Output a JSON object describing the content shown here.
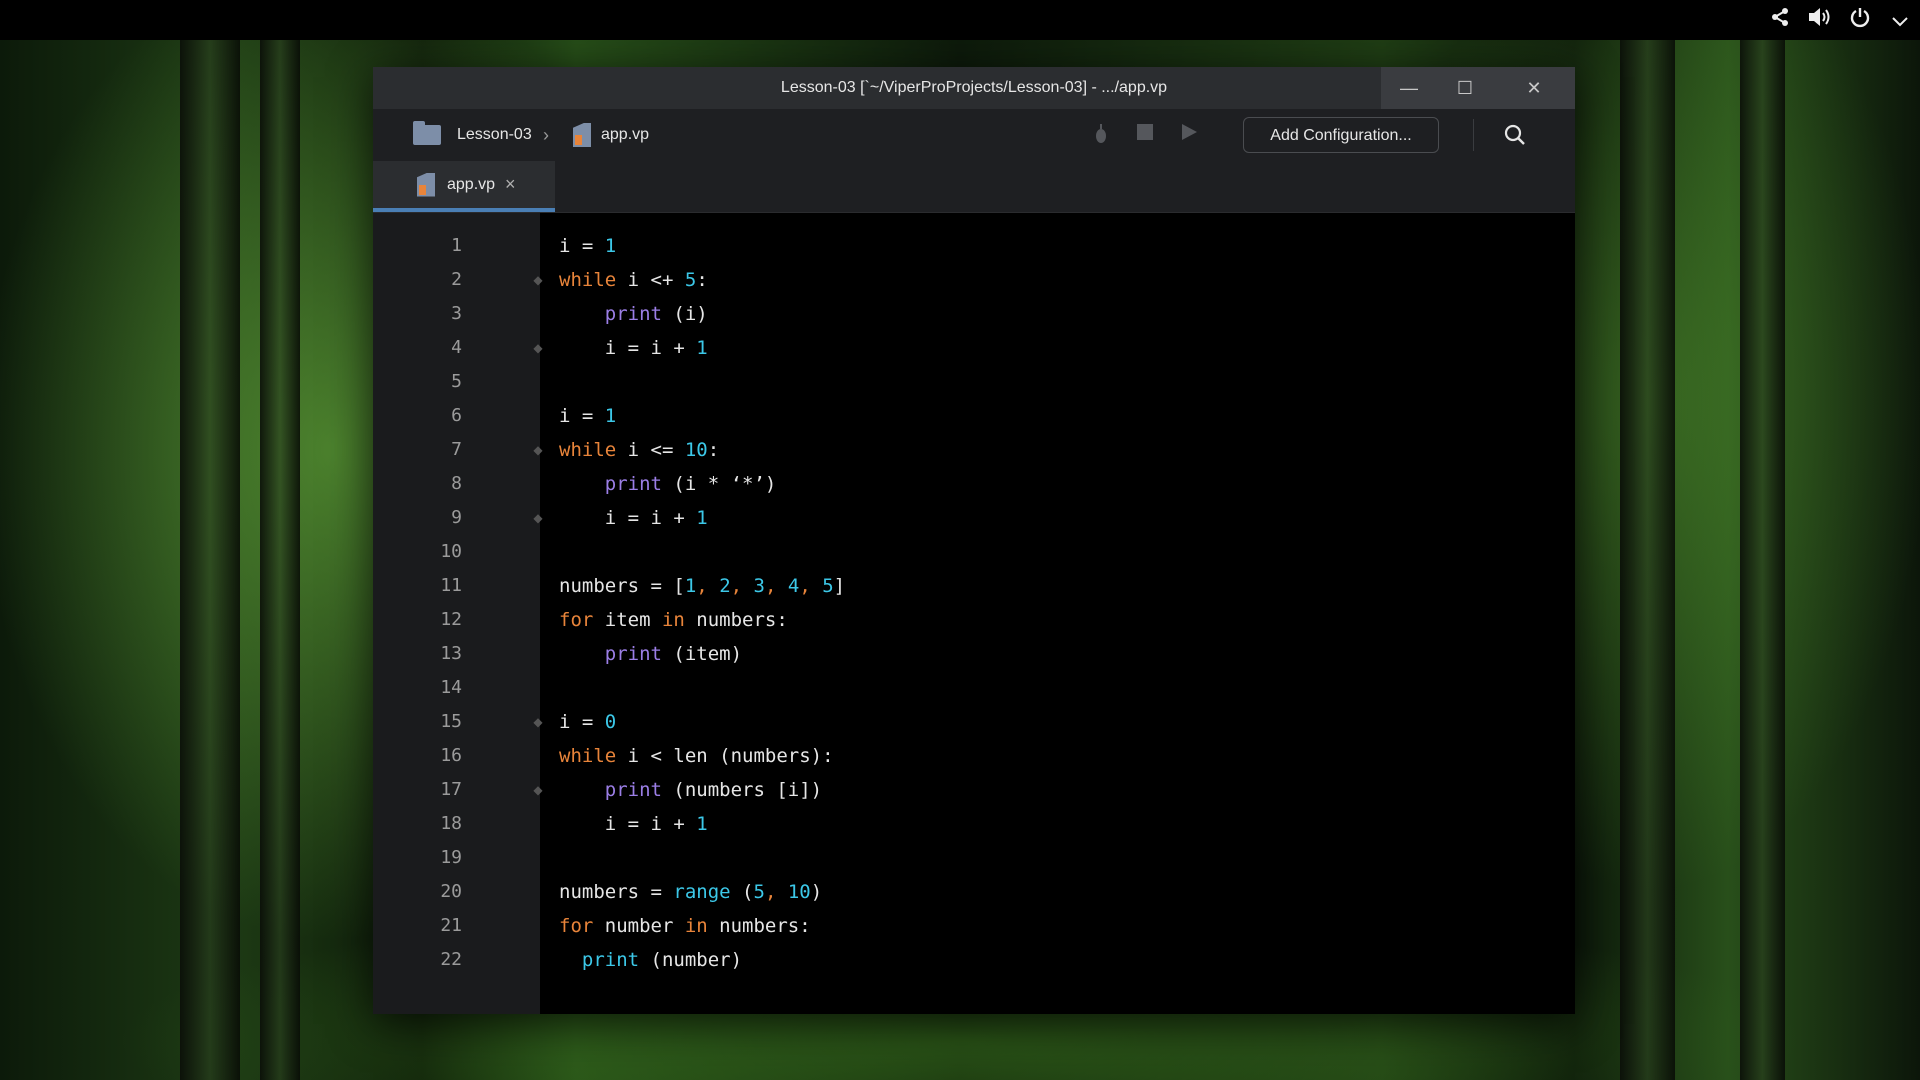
{
  "system_tray": {
    "icons": [
      "share-icon",
      "volume-icon",
      "power-icon",
      "chevron-down-icon"
    ]
  },
  "window": {
    "title": "Lesson-03 [`~/ViperProProjects/Lesson-03] - .../app.vp",
    "controls": {
      "minimize": "—",
      "maximize": "☐",
      "close": "✕"
    }
  },
  "navbar": {
    "project": "Lesson-03",
    "separator": "›",
    "file": "app.vp",
    "add_config_label": "Add Configuration..."
  },
  "tabs": [
    {
      "label": "app.vp",
      "active": true,
      "close": "×"
    }
  ],
  "editor": {
    "lines": [
      {
        "n": "1",
        "indent": "",
        "tokens": [
          [
            "id",
            "i"
          ],
          [
            "op",
            " = "
          ],
          [
            "num",
            "1"
          ]
        ]
      },
      {
        "n": "2",
        "indent": "",
        "tokens": [
          [
            "kw",
            "while"
          ],
          [
            "id",
            " i "
          ],
          [
            "op",
            "<+ "
          ],
          [
            "num",
            "5"
          ],
          [
            "op",
            ":"
          ]
        ],
        "fold": true
      },
      {
        "n": "3",
        "indent": "    ",
        "tokens": [
          [
            "fn",
            "print"
          ],
          [
            "op",
            " (i)"
          ]
        ]
      },
      {
        "n": "4",
        "indent": "    ",
        "tokens": [
          [
            "id",
            "i"
          ],
          [
            "op",
            " = i + "
          ],
          [
            "num",
            "1"
          ]
        ],
        "fold": true
      },
      {
        "n": "5",
        "indent": "",
        "tokens": []
      },
      {
        "n": "6",
        "indent": "",
        "tokens": [
          [
            "id",
            "i"
          ],
          [
            "op",
            " = "
          ],
          [
            "num",
            "1"
          ]
        ]
      },
      {
        "n": "7",
        "indent": "",
        "tokens": [
          [
            "kw",
            "while"
          ],
          [
            "id",
            " i "
          ],
          [
            "op",
            "<= "
          ],
          [
            "num",
            "10"
          ],
          [
            "op",
            ":"
          ]
        ],
        "fold": true
      },
      {
        "n": "8",
        "indent": "    ",
        "tokens": [
          [
            "fn",
            "print"
          ],
          [
            "op",
            " (i * ‘*’)"
          ]
        ]
      },
      {
        "n": "9",
        "indent": "    ",
        "tokens": [
          [
            "id",
            "i"
          ],
          [
            "op",
            " = i + "
          ],
          [
            "num",
            "1"
          ]
        ],
        "fold": true
      },
      {
        "n": "10",
        "indent": "",
        "tokens": []
      },
      {
        "n": "11",
        "indent": "",
        "tokens": [
          [
            "id",
            "numbers"
          ],
          [
            "op",
            " = ["
          ],
          [
            "num",
            "1"
          ],
          [
            "kw",
            ", "
          ],
          [
            "num",
            "2"
          ],
          [
            "kw",
            ", "
          ],
          [
            "num",
            "3"
          ],
          [
            "kw",
            ", "
          ],
          [
            "num",
            "4"
          ],
          [
            "kw",
            ", "
          ],
          [
            "num",
            "5"
          ],
          [
            "op",
            "]"
          ]
        ]
      },
      {
        "n": "12",
        "indent": "",
        "tokens": [
          [
            "kw",
            "for"
          ],
          [
            "id",
            " item "
          ],
          [
            "kw",
            "in"
          ],
          [
            "id",
            " numbers:"
          ]
        ]
      },
      {
        "n": "13",
        "indent": "    ",
        "tokens": [
          [
            "fn",
            "print"
          ],
          [
            "op",
            " (item)"
          ]
        ]
      },
      {
        "n": "14",
        "indent": "",
        "tokens": []
      },
      {
        "n": "15",
        "indent": "",
        "tokens": [
          [
            "id",
            "i"
          ],
          [
            "op",
            " = "
          ],
          [
            "num",
            "0"
          ]
        ],
        "fold": true
      },
      {
        "n": "16",
        "indent": "",
        "tokens": [
          [
            "kw",
            "while"
          ],
          [
            "id",
            " i < len (numbers):"
          ]
        ]
      },
      {
        "n": "17",
        "indent": "    ",
        "tokens": [
          [
            "fn",
            "print"
          ],
          [
            "op",
            " (numbers [i])"
          ]
        ],
        "fold": true
      },
      {
        "n": "18",
        "indent": "    ",
        "tokens": [
          [
            "id",
            "i"
          ],
          [
            "op",
            " = i + "
          ],
          [
            "num",
            "1"
          ]
        ]
      },
      {
        "n": "19",
        "indent": "",
        "tokens": []
      },
      {
        "n": "20",
        "indent": "",
        "tokens": [
          [
            "id",
            "numbers"
          ],
          [
            "op",
            " = "
          ],
          [
            "bi",
            "range"
          ],
          [
            "op",
            " ("
          ],
          [
            "num",
            "5"
          ],
          [
            "kw",
            ", "
          ],
          [
            "num",
            "10"
          ],
          [
            "op",
            ")"
          ]
        ]
      },
      {
        "n": "21",
        "indent": "",
        "tokens": [
          [
            "kw",
            "for"
          ],
          [
            "id",
            " number "
          ],
          [
            "kw",
            "in"
          ],
          [
            "id",
            " numbers:"
          ]
        ]
      },
      {
        "n": "22",
        "indent": "  ",
        "tokens": [
          [
            "bi",
            "print"
          ],
          [
            "op",
            " (number)"
          ]
        ]
      }
    ]
  }
}
